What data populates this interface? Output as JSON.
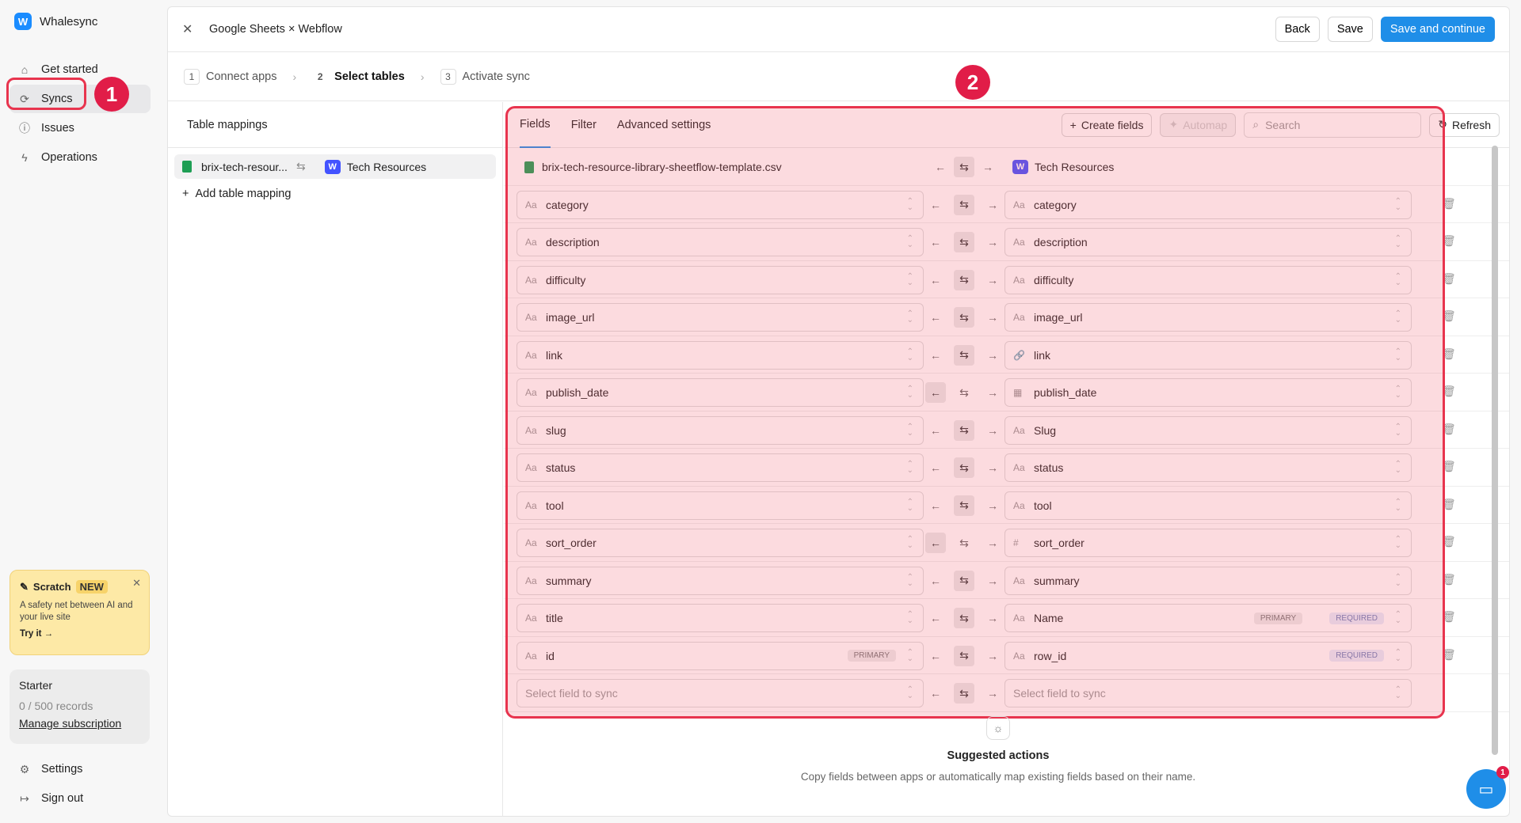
{
  "app": {
    "name": "Whalesync"
  },
  "sidebar": {
    "items": [
      {
        "label": "Get started",
        "icon": "rocket-icon"
      },
      {
        "label": "Syncs",
        "icon": "sync-icon",
        "active": true
      },
      {
        "label": "Issues",
        "icon": "alert-circle-icon"
      },
      {
        "label": "Operations",
        "icon": "bolt-icon"
      }
    ],
    "promo": {
      "title": "Scratch",
      "badge": "NEW",
      "text": "A safety net between AI and your live site",
      "cta": "Try it →"
    },
    "plan": {
      "name": "Starter",
      "records": "0 / 500 records",
      "manage": "Manage subscription"
    },
    "bottom": [
      {
        "label": "Settings",
        "icon": "gear-icon"
      },
      {
        "label": "Sign out",
        "icon": "logout-icon"
      }
    ]
  },
  "annotations": {
    "one": "1",
    "two": "2"
  },
  "header": {
    "title": "Google Sheets × Webflow",
    "back": "Back",
    "save": "Save",
    "save_continue": "Save and continue"
  },
  "steps": [
    {
      "num": "1",
      "label": "Connect apps"
    },
    {
      "num": "2",
      "label": "Select tables",
      "active": true
    },
    {
      "num": "3",
      "label": "Activate sync"
    }
  ],
  "left_panel": {
    "title": "Table mappings",
    "mapping": {
      "source": "brix-tech-resour...",
      "target": "Tech Resources"
    },
    "add": "Add table mapping"
  },
  "toolbar": {
    "tabs": [
      "Fields",
      "Filter",
      "Advanced settings"
    ],
    "create_fields": "Create fields",
    "automap": "Automap",
    "search_placeholder": "Search",
    "refresh": "Refresh"
  },
  "table_header": {
    "source": "brix-tech-resource-library-sheetflow-template.csv",
    "target": "Tech Resources"
  },
  "field_rows": [
    {
      "left": "category",
      "right": "category",
      "right_icon": "Aa",
      "dir": "both"
    },
    {
      "left": "description",
      "right": "description",
      "right_icon": "Aa",
      "dir": "both"
    },
    {
      "left": "difficulty",
      "right": "difficulty",
      "right_icon": "Aa",
      "dir": "both"
    },
    {
      "left": "image_url",
      "right": "image_url",
      "right_icon": "Aa",
      "dir": "both"
    },
    {
      "left": "link",
      "right": "link",
      "right_icon": "🔗",
      "dir": "both"
    },
    {
      "left": "publish_date",
      "right": "publish_date",
      "right_icon": "▦",
      "dir": "left"
    },
    {
      "left": "slug",
      "right": "Slug",
      "right_icon": "Aa",
      "dir": "both"
    },
    {
      "left": "status",
      "right": "status",
      "right_icon": "Aa",
      "dir": "both"
    },
    {
      "left": "tool",
      "right": "tool",
      "right_icon": "Aa",
      "dir": "both"
    },
    {
      "left": "sort_order",
      "right": "sort_order",
      "right_icon": "#",
      "dir": "left"
    },
    {
      "left": "summary",
      "right": "summary",
      "right_icon": "Aa",
      "dir": "both"
    },
    {
      "left": "title",
      "right": "Name",
      "right_icon": "Aa",
      "dir": "both",
      "right_pills": [
        "PRIMARY",
        "REQUIRED"
      ]
    },
    {
      "left": "id",
      "right": "row_id",
      "right_icon": "Aa",
      "dir": "both",
      "left_pills": [
        "PRIMARY"
      ],
      "right_pills": [
        "REQUIRED"
      ]
    }
  ],
  "empty_row": {
    "left": "Select field to sync",
    "right": "Select field to sync"
  },
  "suggest": {
    "title": "Suggested actions",
    "desc": "Copy fields between apps or automatically map existing fields based on their name."
  },
  "chat": {
    "count": "1"
  },
  "colors": {
    "accent": "#1f8ee8",
    "highlight": "#e8344e"
  }
}
